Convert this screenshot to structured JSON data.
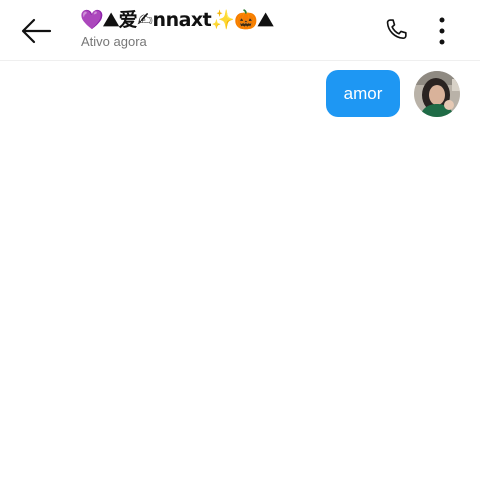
{
  "header": {
    "contact_name": "💜⛰爱✍nnaxt✨🎃⛰",
    "status": "Ativo agora",
    "icons": {
      "back": "arrow-left-icon",
      "call": "phone-icon",
      "more": "vertical-dots-icon"
    }
  },
  "messages": [
    {
      "text": "amor",
      "sender": "me"
    }
  ],
  "colors": {
    "bubble": "#1e97f3",
    "bubble_text": "#ffffff",
    "status_text": "#777777"
  }
}
